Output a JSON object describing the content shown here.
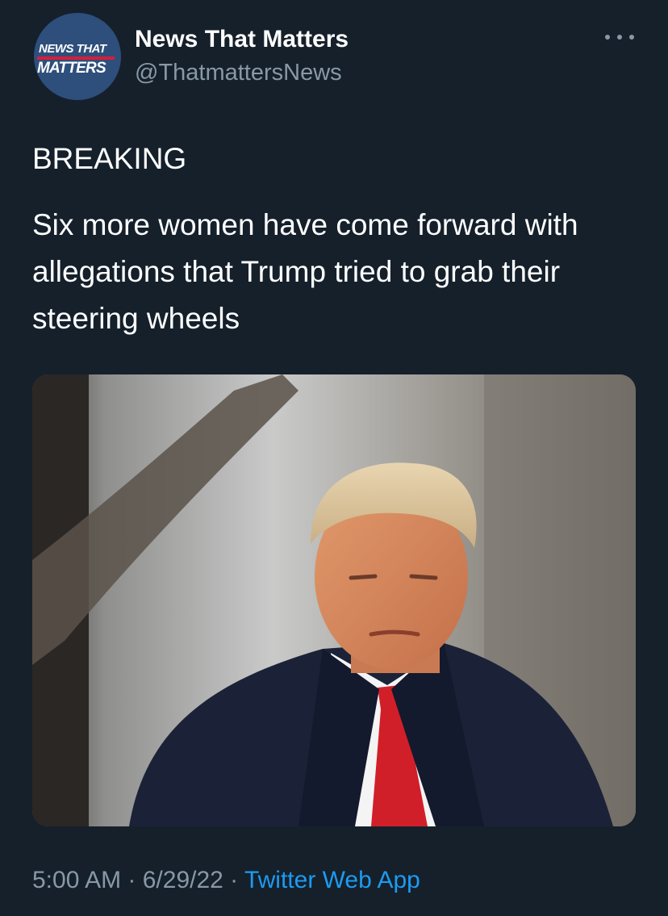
{
  "account": {
    "avatar_line1": "NEWS THAT",
    "avatar_line2": "MATTERS",
    "display_name": "News That Matters",
    "handle": "@ThatmattersNews"
  },
  "tweet": {
    "label": "BREAKING",
    "text": "Six more women have come forward with allegations that Trump tried to grab their steering wheels"
  },
  "footer": {
    "time": "5:00 AM",
    "sep1": " · ",
    "date": "6/29/22",
    "sep2": " · ",
    "source": "Twitter Web App"
  },
  "icons": {
    "more": "more-options-icon"
  },
  "colors": {
    "background": "#15202b",
    "secondary_text": "#8899a6",
    "link": "#1d9bf0",
    "avatar_bg": "#2e4f7c",
    "avatar_accent": "#d3203a"
  }
}
